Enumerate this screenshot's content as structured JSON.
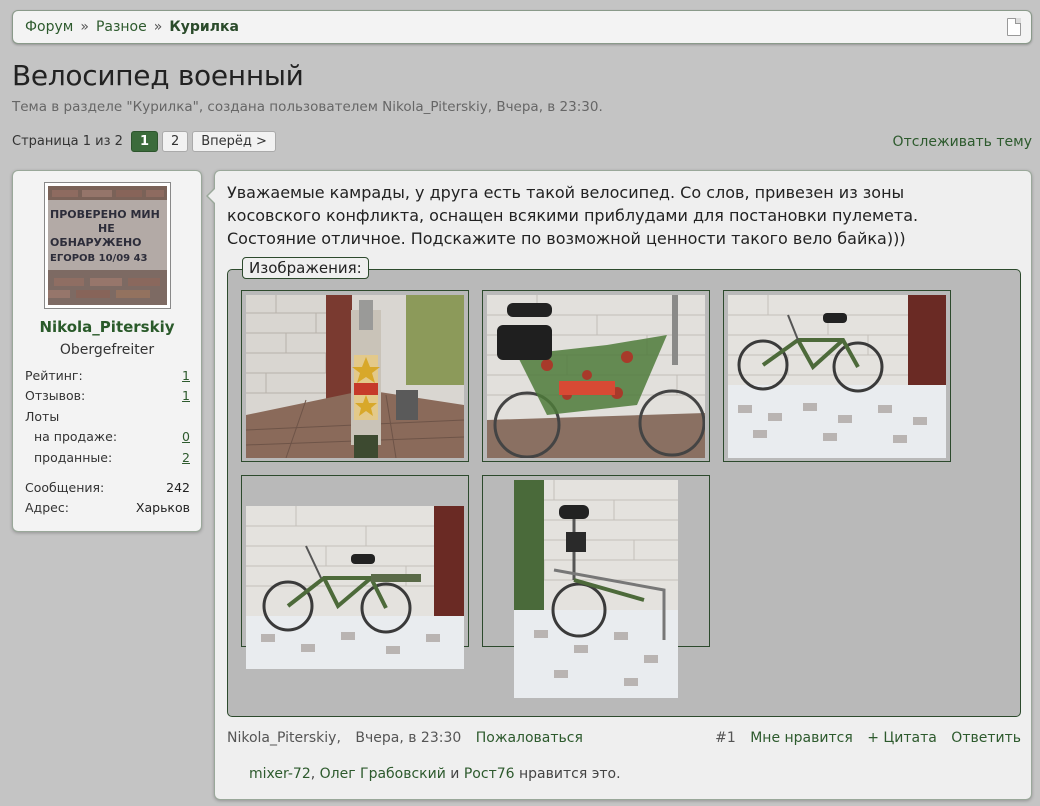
{
  "breadcrumb": {
    "items": [
      "Форум",
      "Разное"
    ],
    "separator": "»",
    "current": "Курилка",
    "icon": "document-icon"
  },
  "thread": {
    "title": "Велосипед военный",
    "subtitle": "Тема в разделе \"Курилка\", создана пользователем Nikola_Piterskiy, Вчера, в 23:30."
  },
  "pagination": {
    "label": "Страница 1 из 2",
    "pages": [
      "1",
      "2"
    ],
    "active": "1",
    "next": "Вперёд >"
  },
  "watch_label": "Отслеживать тему",
  "user": {
    "name": "Nikola_Piterskiy",
    "title": "Obergefreiter",
    "avatar_text": [
      "ПРОВЕРЕНО МИН",
      "НЕ",
      "ОБНАРУЖЕНО",
      "ЕГОРОВ 10/09 43"
    ],
    "stats": {
      "rating_label": "Рейтинг:",
      "rating": "1",
      "reviews_label": "Отзывов:",
      "reviews": "1",
      "lots_label": "Лоты",
      "selling_label": "на продаже:",
      "selling": "0",
      "sold_label": "проданные:",
      "sold": "2",
      "messages_label": "Сообщения:",
      "messages": "242",
      "address_label": "Адрес:",
      "address": "Харьков"
    }
  },
  "post": {
    "text": "Уважаемые камрады, у друга есть такой велосипед. Со слов, привезен из зоны косовского конфликта, оснащен всякими приблудами для постановки пулемета. Состояние отличное. Подскажите по возможной ценности такого вело байка)))",
    "attachments_label": "Изображения:",
    "author": "Nikola_Piterskiy",
    "date": "Вчера, в 23:30",
    "report": "Пожаловаться",
    "number": "#1",
    "like": "Мне нравится",
    "quote": "+ Цитата",
    "reply": "Ответить",
    "likers": [
      "mixer-72",
      "Олег Грабовский",
      "Рост76"
    ],
    "likes_and": "и",
    "likes_suffix": "нравится это."
  },
  "colors": {
    "accent": "#2d5a2d",
    "background": "#c4c4c4",
    "panel": "#f3f3f3"
  }
}
